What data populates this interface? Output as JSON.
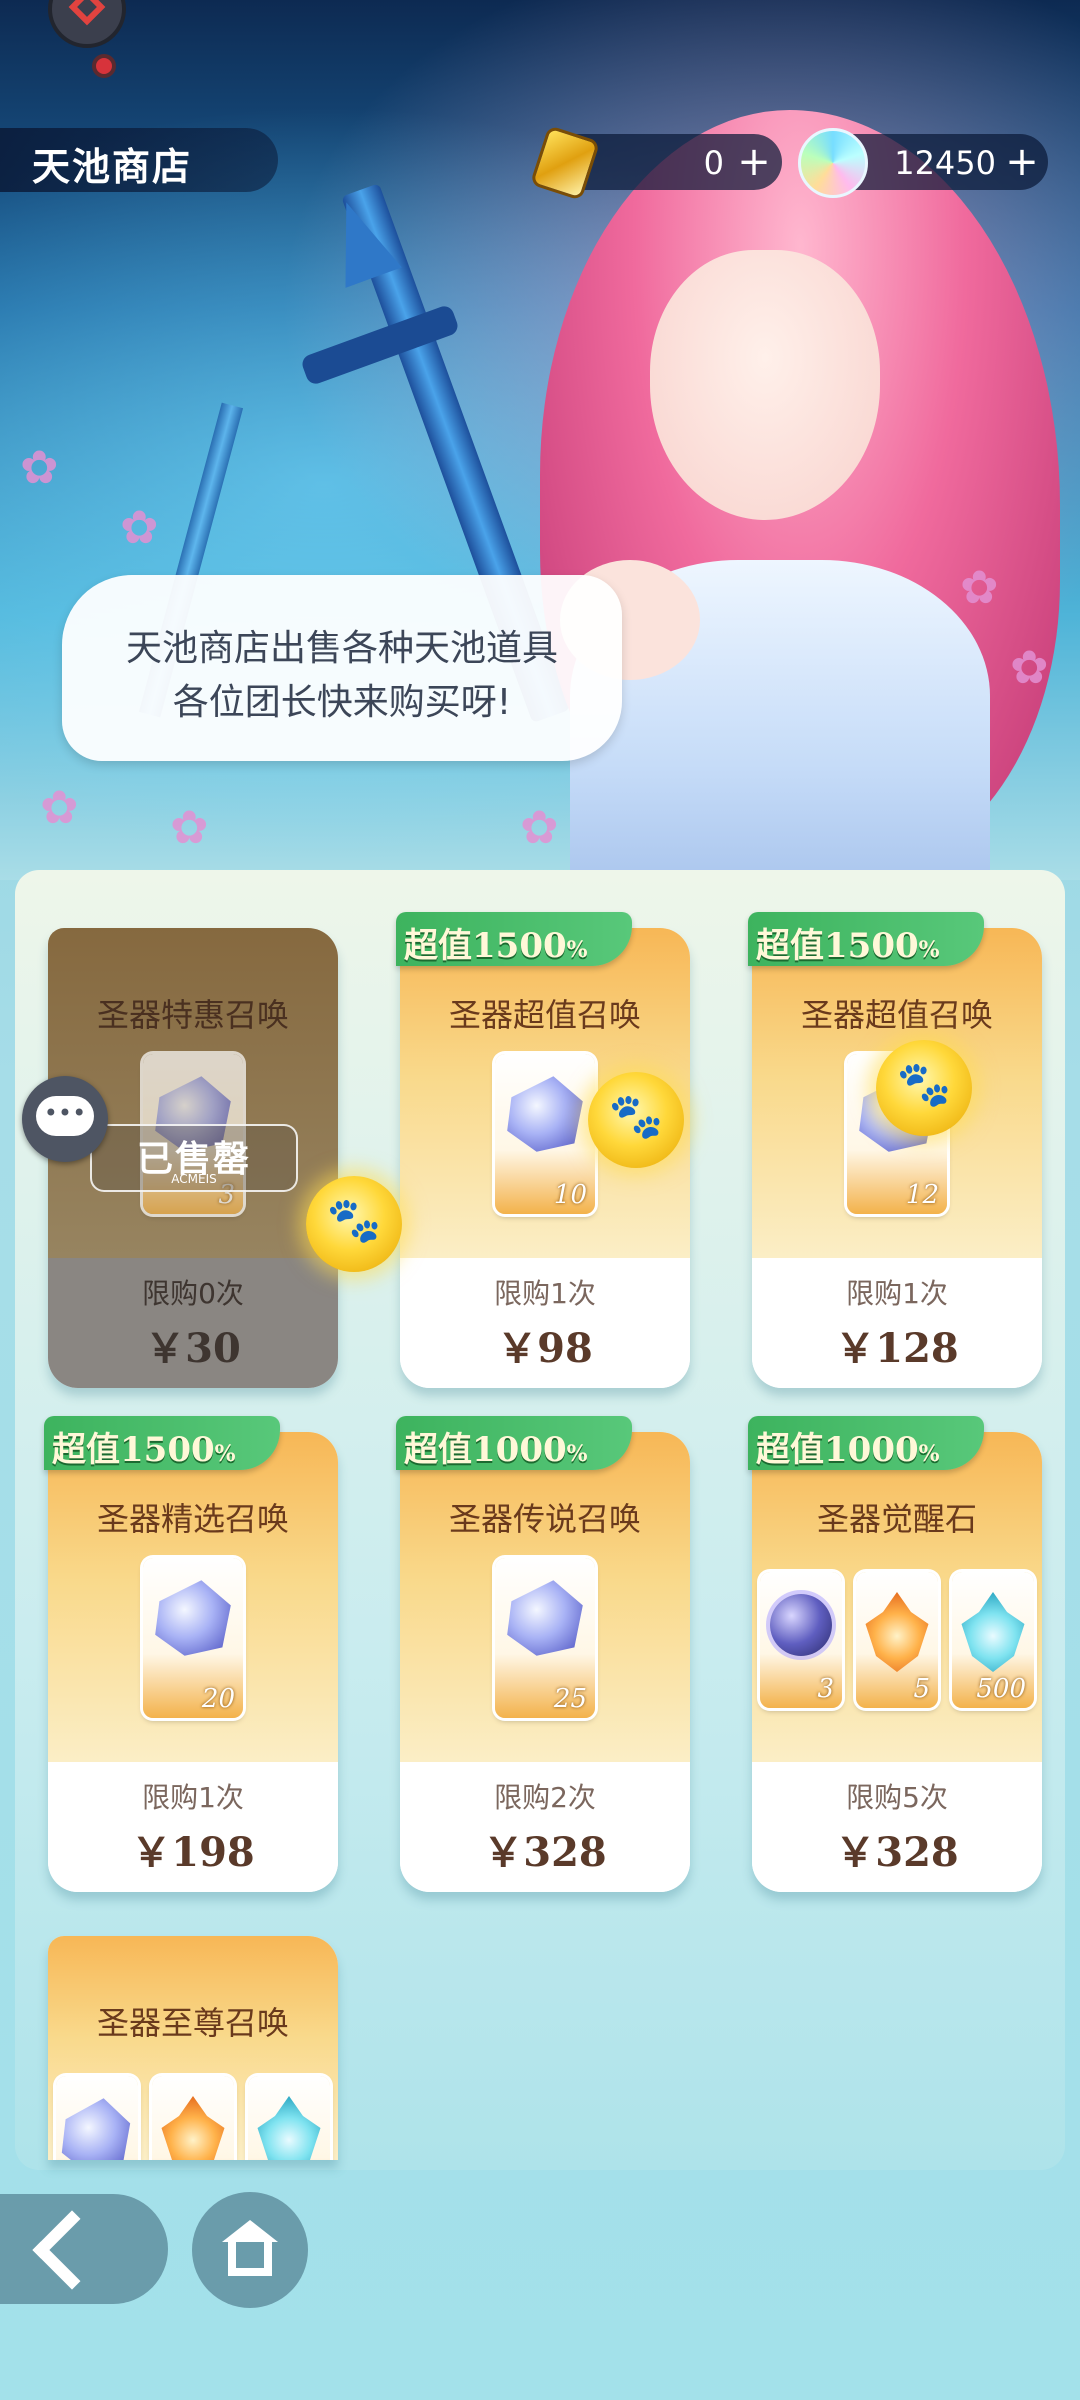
{
  "header": {
    "title": "天池商店",
    "currencies": [
      {
        "icon": "gold-crystal-icon",
        "value": "0"
      },
      {
        "icon": "rainbow-gem-icon",
        "value": "12450"
      }
    ],
    "plus_label": "+"
  },
  "bubble": {
    "line1": "天池商店出售各种天池道具",
    "line2": "各位团长快来购买呀!"
  },
  "sold_stamp": {
    "text": "已售罄",
    "sub": "ACMEIS"
  },
  "cards": [
    {
      "title": "圣器特惠召唤",
      "limit": "限购0次",
      "price": "￥30",
      "badge": "",
      "items": [
        "3"
      ],
      "sold_out": true
    },
    {
      "title": "圣器超值召唤",
      "limit": "限购1次",
      "price": "￥98",
      "badge": "超值1500",
      "items": [
        "10"
      ],
      "sold_out": false
    },
    {
      "title": "圣器超值召唤",
      "limit": "限购1次",
      "price": "￥128",
      "badge": "超值1500",
      "items": [
        "12"
      ],
      "sold_out": false
    },
    {
      "title": "圣器精选召唤",
      "limit": "限购1次",
      "price": "￥198",
      "badge": "超值1500",
      "items": [
        "20"
      ],
      "sold_out": false
    },
    {
      "title": "圣器传说召唤",
      "limit": "限购2次",
      "price": "￥328",
      "badge": "超值1000",
      "items": [
        "25"
      ],
      "sold_out": false
    },
    {
      "title": "圣器觉醒石",
      "limit": "限购5次",
      "price": "￥328",
      "badge": "超值1000",
      "items": [
        "3",
        "5",
        "500"
      ],
      "sold_out": false
    },
    {
      "title": "圣器至尊召唤",
      "limit": "",
      "price": "",
      "badge": "",
      "items": [],
      "sold_out": false
    }
  ],
  "badge_suffix": "%",
  "nav": {
    "back": "back-arrow-icon",
    "home": "home-icon"
  }
}
